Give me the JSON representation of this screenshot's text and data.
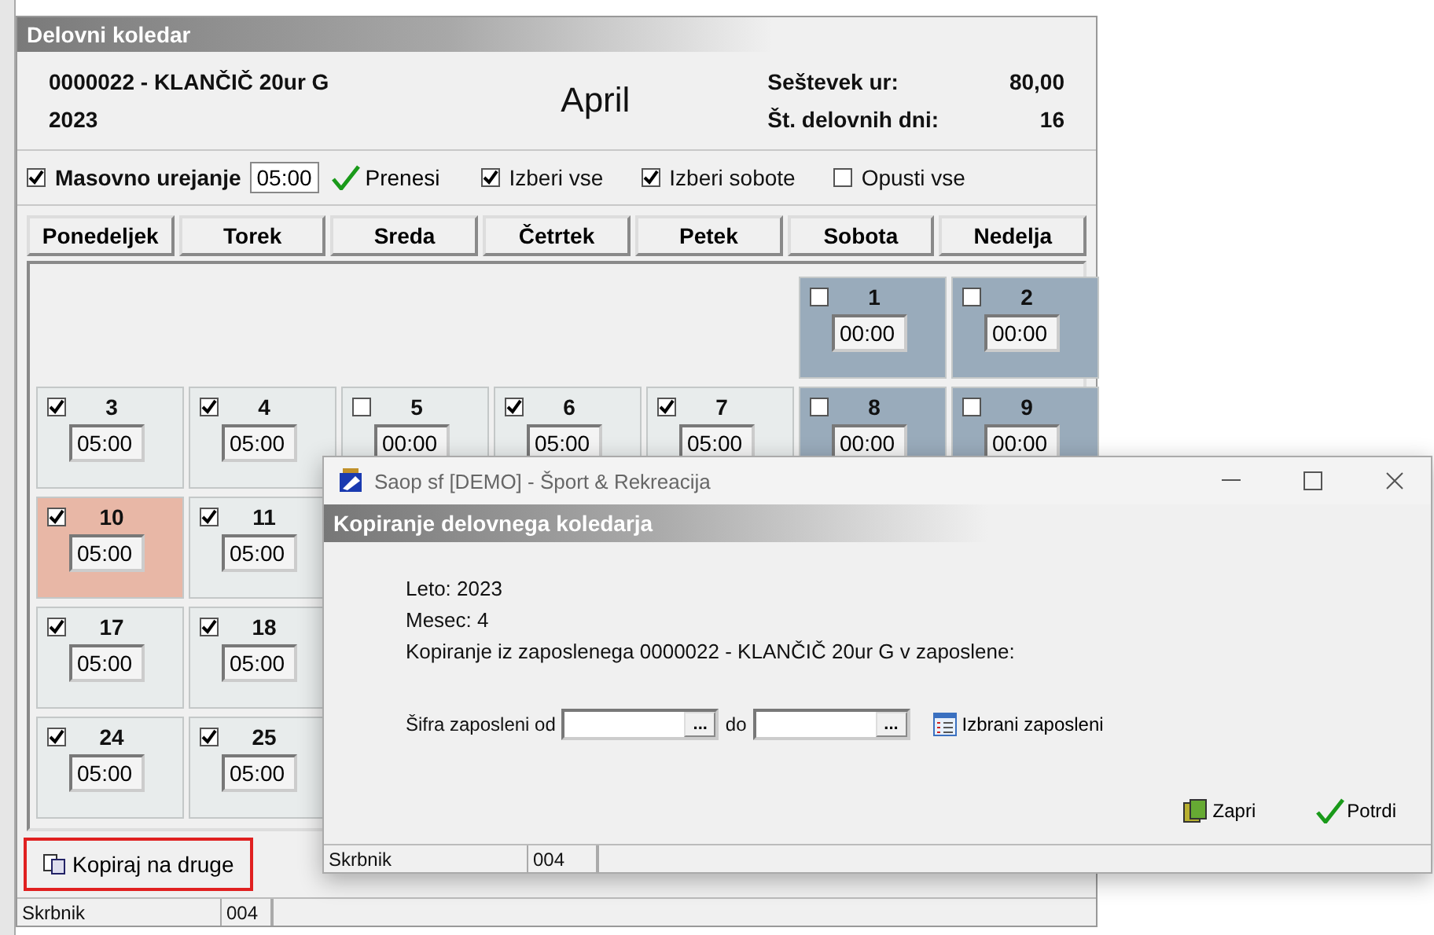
{
  "window": {
    "title": "Delovni koledar"
  },
  "header": {
    "employee": "0000022 - KLANČIČ 20ur G",
    "year": "2023",
    "month": "April",
    "totals": [
      {
        "label": "Seštevek ur:",
        "value": "80,00"
      },
      {
        "label": "Št. delovnih dni:",
        "value": "16"
      }
    ]
  },
  "toolbar": {
    "mass_edit": {
      "label": "Masovno urejanje",
      "checked": true,
      "value": "05:00"
    },
    "transfer": "Prenesi",
    "options": [
      {
        "label": "Izberi vse",
        "checked": true
      },
      {
        "label": "Izberi sobote",
        "checked": true
      },
      {
        "label": "Opusti vse",
        "checked": false
      }
    ]
  },
  "weekdays": [
    "Ponedeljek",
    "Torek",
    "Sreda",
    "Četrtek",
    "Petek",
    "Sobota",
    "Nedelja"
  ],
  "weeks": [
    [
      {
        "kind": "blank"
      },
      {
        "kind": "blank"
      },
      {
        "kind": "blank"
      },
      {
        "kind": "blank"
      },
      {
        "kind": "blank"
      },
      {
        "kind": "weekend",
        "day": "1",
        "checked": false,
        "time": "00:00"
      },
      {
        "kind": "weekend",
        "day": "2",
        "checked": false,
        "time": "00:00"
      }
    ],
    [
      {
        "kind": "workday",
        "day": "3",
        "checked": true,
        "time": "05:00"
      },
      {
        "kind": "workday",
        "day": "4",
        "checked": true,
        "time": "05:00"
      },
      {
        "kind": "workday",
        "day": "5",
        "checked": false,
        "time": "00:00"
      },
      {
        "kind": "workday",
        "day": "6",
        "checked": true,
        "time": "05:00"
      },
      {
        "kind": "workday",
        "day": "7",
        "checked": true,
        "time": "05:00"
      },
      {
        "kind": "weekend",
        "day": "8",
        "checked": false,
        "time": "00:00"
      },
      {
        "kind": "weekend",
        "day": "9",
        "checked": false,
        "time": "00:00"
      }
    ],
    [
      {
        "kind": "holiday",
        "day": "10",
        "checked": true,
        "time": "05:00"
      },
      {
        "kind": "workday",
        "day": "11",
        "checked": true,
        "time": "05:00"
      }
    ],
    [
      {
        "kind": "workday",
        "day": "17",
        "checked": true,
        "time": "05:00"
      },
      {
        "kind": "workday",
        "day": "18",
        "checked": true,
        "time": "05:00"
      }
    ],
    [
      {
        "kind": "workday",
        "day": "24",
        "checked": true,
        "time": "05:00"
      },
      {
        "kind": "workday",
        "day": "25",
        "checked": true,
        "time": "05:00"
      }
    ]
  ],
  "copy_button": "Kopiraj na druge",
  "status_bar": [
    "Skrbnik",
    "004"
  ],
  "dialog": {
    "title": "Saop sf [DEMO] - Šport & Rekreacija",
    "heading": "Kopiranje delovnega koledarja",
    "lines": [
      "Leto: 2023",
      "Mesec: 4",
      "Kopiranje iz zaposlenega 0000022 - KLANČIČ 20ur G v zaposlene:"
    ],
    "range": {
      "from_label": "Šifra zaposleni od",
      "to_label": "do",
      "browse": "...",
      "selected_link": "Izbrani zaposleni"
    },
    "buttons": [
      {
        "kind": "close",
        "label": "Zapri"
      },
      {
        "kind": "confirm",
        "label": "Potrdi"
      }
    ],
    "status_bar": [
      "Skrbnik",
      "004"
    ]
  }
}
